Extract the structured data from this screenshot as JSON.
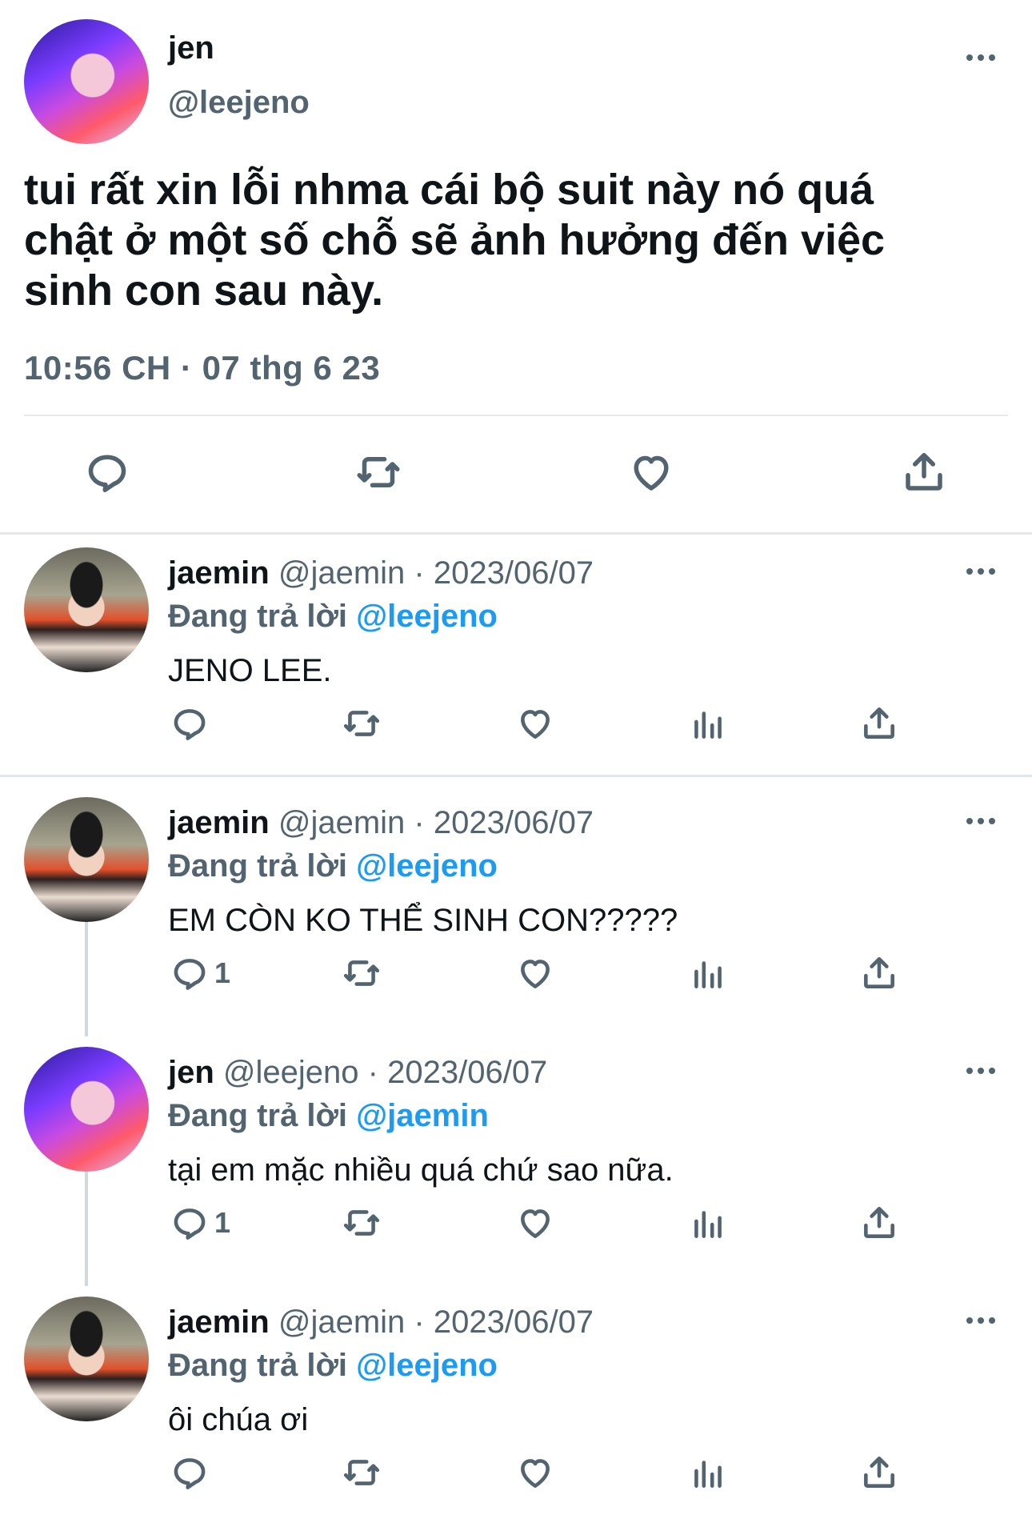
{
  "main_tweet": {
    "name": "jen",
    "handle": "@leejeno",
    "text_lines": [
      "tui rất xin lỗi nhma cái bộ suit này nó quá",
      "chật ở một số chỗ sẽ ảnh hưởng đến việc",
      "sinh con sau này."
    ],
    "timestamp": "10:56 CH · 07 thg 6 23",
    "actions": [
      "reply-icon",
      "retweet-icon",
      "like-icon",
      "share-icon"
    ]
  },
  "replies": [
    {
      "name": "jaemin",
      "handle": "@jaemin",
      "separator": "·",
      "date": "2023/06/07",
      "replying_prefix": "Đang trả lời",
      "replying_to": "@leejeno",
      "text": "JENO LEE.",
      "reply_count": "",
      "avatar": "jaemin"
    },
    {
      "name": "jaemin",
      "handle": "@jaemin",
      "separator": "·",
      "date": "2023/06/07",
      "replying_prefix": "Đang trả lời",
      "replying_to": "@leejeno",
      "text": "EM CÒN KO THỂ SINH CON?????",
      "reply_count": "1",
      "avatar": "jaemin"
    },
    {
      "name": "jen",
      "handle": "@leejeno",
      "separator": "·",
      "date": "2023/06/07",
      "replying_prefix": "Đang trả lời",
      "replying_to": "@jaemin",
      "text": "tại em mặc nhiều quá chứ sao nữa.",
      "reply_count": "1",
      "avatar": "jen"
    },
    {
      "name": "jaemin",
      "handle": "@jaemin",
      "separator": "·",
      "date": "2023/06/07",
      "replying_prefix": "Đang trả lời",
      "replying_to": "@leejeno",
      "text": "ôi chúa ơi",
      "reply_count": "",
      "avatar": "jaemin"
    }
  ],
  "colors": {
    "text_primary": "#0f1419",
    "text_secondary": "#536471",
    "mention": "#1d9bf0",
    "divider": "#e3e6ea"
  }
}
